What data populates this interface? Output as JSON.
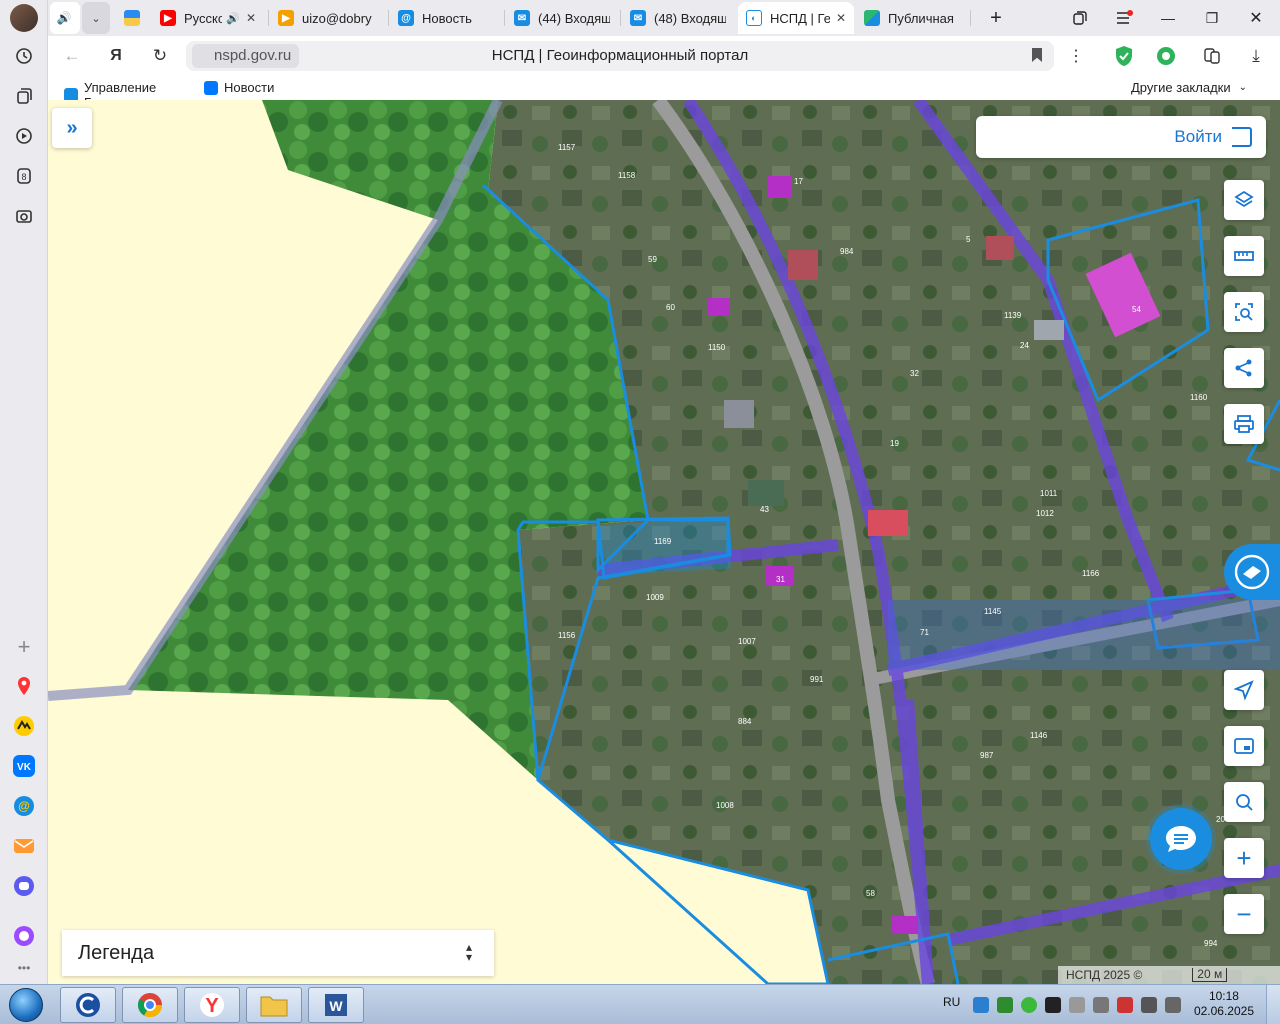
{
  "browser": {
    "tabs": [
      {
        "title": "",
        "favicon": "speaker-icon"
      },
      {
        "title": "",
        "favicon": "chevron-down-icon"
      },
      {
        "title": "",
        "favicon": "gov-icon"
      },
      {
        "title": "Русско",
        "favicon": "youtube-icon"
      },
      {
        "title": "uizo@dobry",
        "favicon": "mail-icon"
      },
      {
        "title": "Новость",
        "favicon": "at-icon"
      },
      {
        "title": "(44) Входящ",
        "favicon": "mail-icon"
      },
      {
        "title": "(48) Входящ",
        "favicon": "mail-icon"
      },
      {
        "title": "НСПД | Ге",
        "favicon": "nspd-icon",
        "active": true
      },
      {
        "title": "Публичная",
        "favicon": "map-icon"
      }
    ],
    "address": {
      "domain": "nspd.gov.ru",
      "page_title": "НСПД | Геоинформационный портал"
    },
    "bookmarks": [
      {
        "label": "Управление Град"
      },
      {
        "label": "Новости"
      }
    ],
    "other_bookmarks": "Другие закладки"
  },
  "map": {
    "login_label": "Войти",
    "legend_label": "Легенда",
    "copyright": "НСПД 2025 ©",
    "scale_label": "20 м",
    "parcel_numbers": [
      "1157",
      "1158",
      "59",
      "60",
      "1150",
      "43",
      "1169",
      "1009",
      "31",
      "1156",
      "1007",
      "991",
      "884",
      "1008",
      "58",
      "17",
      "984",
      "5",
      "1139",
      "24",
      "32",
      "19",
      "54",
      "1160",
      "1011",
      "1012",
      "1166",
      "1145",
      "71",
      "987",
      "1146",
      "994",
      "20"
    ]
  },
  "taskbar": {
    "lang": "RU",
    "time": "10:18",
    "date": "02.06.2025"
  }
}
